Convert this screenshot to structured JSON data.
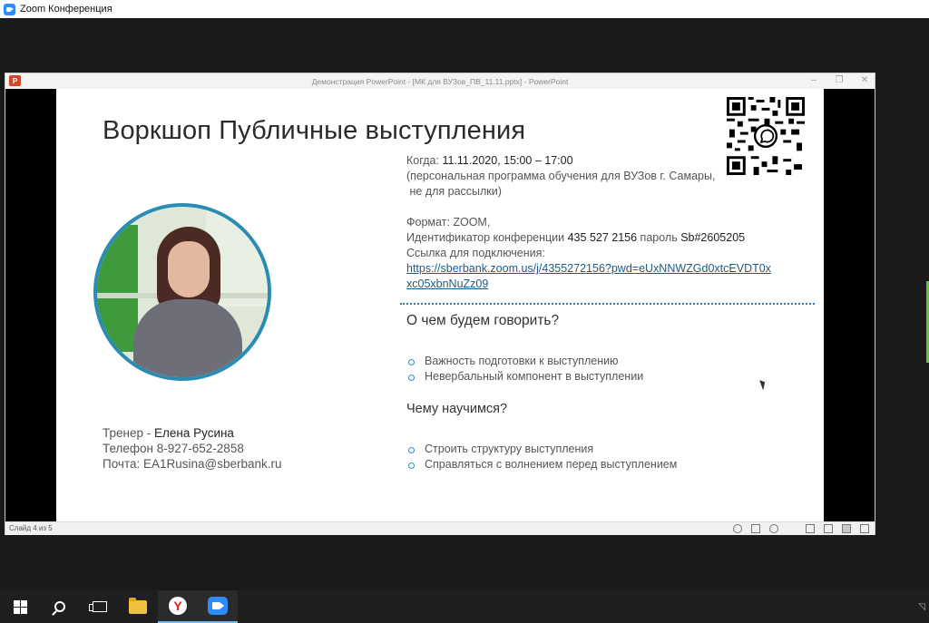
{
  "zoom": {
    "title": "Zoom Конференция"
  },
  "ppt": {
    "window_title": "Демонстрация PowerPoint - [МК для ВУЗов_ПВ_11.11.pptx] - PowerPoint",
    "status": "Слайд 4 из 5",
    "win_buttons": [
      "–",
      "❐",
      "✕"
    ]
  },
  "slide": {
    "title": "Воркшоп Публичные выступления",
    "when_label": "Когда: ",
    "when_value": "11.11.2020, 15:00 – 17:00",
    "note_line1": "(персональная программа обучения для ВУЗов г. Самары,",
    "note_line2": " не для рассылки)",
    "format_line": "Формат: ZOOM,",
    "conf_id_label": "Идентификатор конференции ",
    "conf_id_value": "435 527 2156",
    "password_label": " пароль ",
    "password_value": "Sb#2605205",
    "link_label": "Ссылка для подключения:",
    "link_url": "https://sberbank.zoom.us/j/4355272156?pwd=eUxNNWZGd0xtcEVDT0xxc05xbnNuZz09",
    "link_line1": "https://sberbank.zoom.us/j/4355272156?pwd=eUxNNWZGd0xtcEVDT0x",
    "link_line2": "xc05xbnNuZz09",
    "section1_title": "О чем будем говорить?",
    "section1_items": [
      "Важность подготовки к выступлению",
      "Невербальный компонент в выступлении"
    ],
    "section2_title": "Чему научимся?",
    "section2_items": [
      "Строить структуру выступления",
      "Справляться с волнением перед выступлением"
    ],
    "trainer_label": "Тренер - ",
    "trainer_name": "Елена Русина",
    "phone": "Телефон 8-927-652-2858",
    "email": "Почта: EA1Rusina@sberbank.ru"
  },
  "colors": {
    "accent_blue": "#2a7fb0",
    "link": "#1a5c8c",
    "photo_ring": "#2a8cb3",
    "ppt_red": "#d24726",
    "zoom_blue": "#2d8cff"
  },
  "taskbar": {
    "icons": [
      "windows-start-icon",
      "search-icon",
      "task-view-icon",
      "file-explorer-icon",
      "yandex-browser-icon",
      "zoom-app-icon"
    ]
  }
}
